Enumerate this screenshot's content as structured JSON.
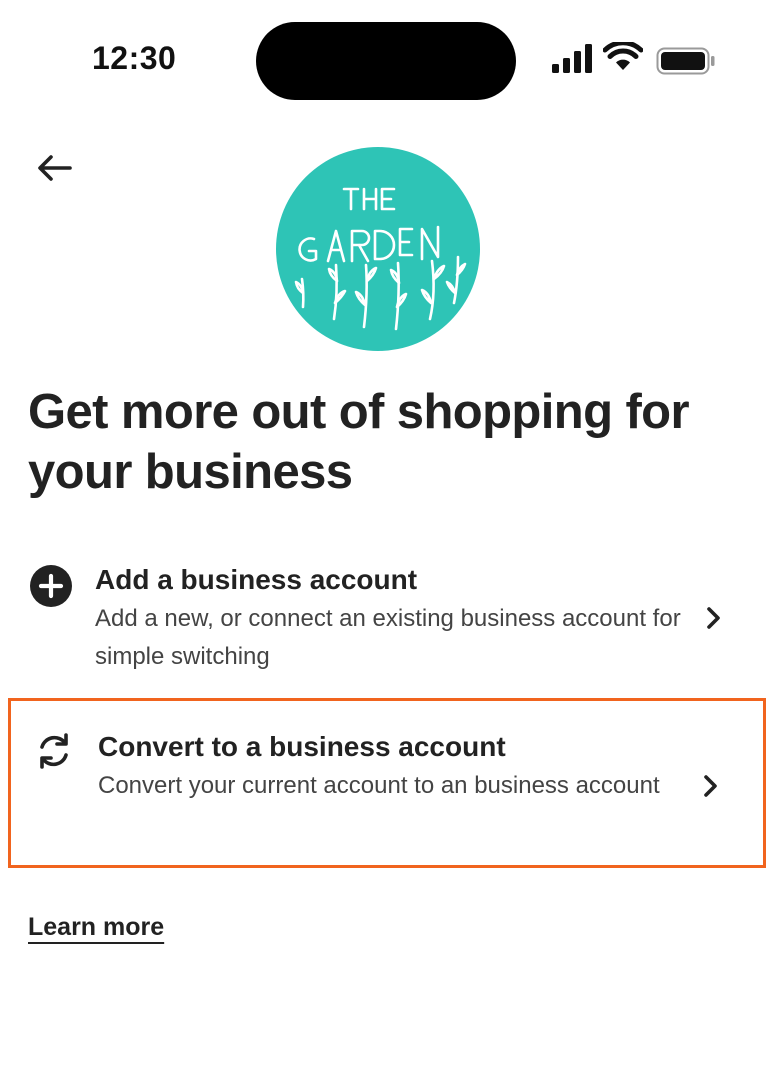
{
  "status_bar": {
    "time": "12:30",
    "icons": [
      "cellular-signal-icon",
      "wifi-icon",
      "battery-icon"
    ]
  },
  "header": {
    "back_icon": "arrow-left-icon"
  },
  "logo": {
    "shop_name": "THE GARDEN",
    "background_color": "#2ec4b6"
  },
  "page": {
    "title": "Get more out of shopping for your business"
  },
  "options": [
    {
      "icon": "plus-circle-icon",
      "title": "Add a business account",
      "description": "Add a new, or connect an existing business account for simple switching"
    },
    {
      "icon": "refresh-icon",
      "title": "Convert to a business account",
      "description": "Convert your current account to an business account",
      "highlighted": true
    }
  ],
  "footer": {
    "learn_more_label": "Learn more"
  },
  "colors": {
    "text": "#222222",
    "highlight_border": "#f1641e",
    "logo_teal": "#2ec4b6"
  }
}
